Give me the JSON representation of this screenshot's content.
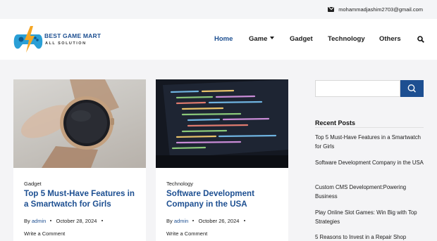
{
  "topbar": {
    "email": "mohammadjashim2703@gmail.com"
  },
  "logo": {
    "title": "BEST GAME MART",
    "subtitle": "ALL SOLUTION"
  },
  "nav": {
    "items": [
      {
        "label": "Home",
        "active": true
      },
      {
        "label": "Game",
        "active": false
      },
      {
        "label": "Gadget",
        "active": false
      },
      {
        "label": "Technology",
        "active": false
      },
      {
        "label": "Others",
        "active": false
      }
    ]
  },
  "posts": [
    {
      "category": "Gadget",
      "title": "Top 5 Must-Have Features in a Smartwatch for Girls",
      "by": "By",
      "author": "admin",
      "date": "October 28, 2024",
      "comment": "Write a Comment"
    },
    {
      "category": "Technology",
      "title": "Software Development Company in the USA",
      "by": "By",
      "author": "admin",
      "date": "October 26, 2024",
      "comment": "Write a Comment"
    }
  ],
  "sidebar": {
    "search_placeholder": "",
    "recent_title": "Recent Posts",
    "recent": [
      "Top 5 Must-Have Features in a Smartwatch for Girls",
      "Software Development Company in the USA",
      "Custom CMS Development:Powering Business",
      "Play Online Slot Games: Win Big with Top Strategies",
      "5 Reasons to Invest in a Repair Shop"
    ]
  },
  "colors": {
    "brand": "#1d4f91",
    "accent_logo": "#f5a623"
  },
  "icons": [
    "mail-icon",
    "chevron-down-icon",
    "search-icon"
  ]
}
